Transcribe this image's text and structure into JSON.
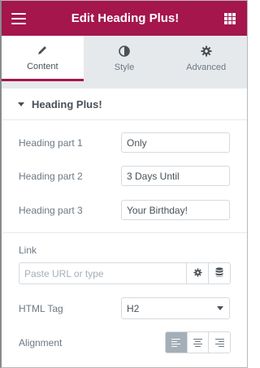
{
  "header": {
    "title": "Edit Heading Plus!",
    "menu_icon": "hamburger-menu-icon",
    "grid_icon": "apps-grid-icon"
  },
  "tabs": [
    {
      "label": "Content",
      "icon": "pencil-icon",
      "active": true
    },
    {
      "label": "Style",
      "icon": "half-circle-icon",
      "active": false
    },
    {
      "label": "Advanced",
      "icon": "gear-icon",
      "active": false
    }
  ],
  "section": {
    "title": "Heading Plus!"
  },
  "fields": {
    "heading1": {
      "label": "Heading part 1",
      "value": "Only"
    },
    "heading2": {
      "label": "Heading part 2",
      "value": "3 Days Until"
    },
    "heading3": {
      "label": "Heading part 3",
      "value": "Your Birthday!"
    }
  },
  "link": {
    "label": "Link",
    "placeholder": "Paste URL or type"
  },
  "html_tag": {
    "label": "HTML Tag",
    "value": "H2"
  },
  "alignment": {
    "label": "Alignment",
    "options": [
      "left",
      "center",
      "right"
    ],
    "selected": "left"
  },
  "colors": {
    "accent": "#a4164c",
    "panel_bg": "#e6e9ec",
    "text": "#6d7882"
  }
}
